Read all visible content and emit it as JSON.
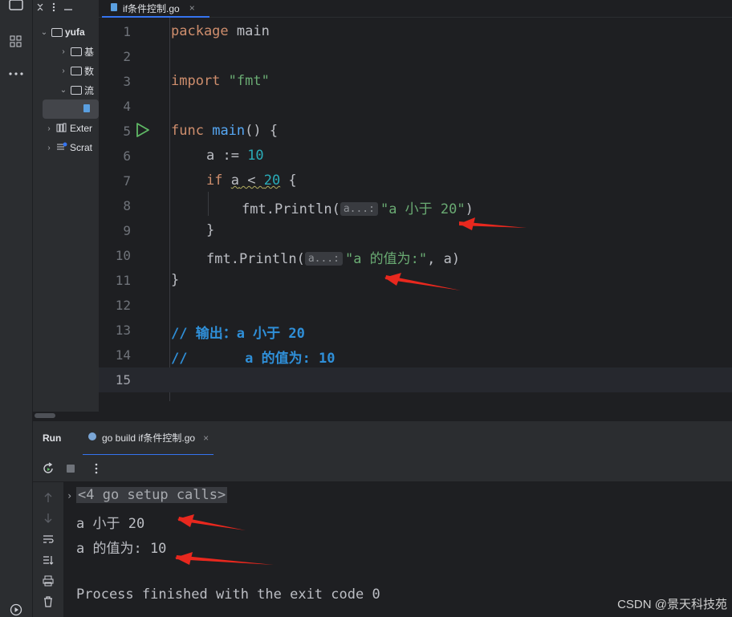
{
  "editor_tab": {
    "filename": "if条件控制.go",
    "close": "×"
  },
  "project": {
    "root": "yufa",
    "items": [
      "基",
      "数",
      "流",
      "Exter",
      "Scrat"
    ]
  },
  "code_lines": [
    {
      "n": "1"
    },
    {
      "n": "2"
    },
    {
      "n": "3"
    },
    {
      "n": "4"
    },
    {
      "n": "5"
    },
    {
      "n": "6"
    },
    {
      "n": "7"
    },
    {
      "n": "8"
    },
    {
      "n": "9"
    },
    {
      "n": "10"
    },
    {
      "n": "11"
    },
    {
      "n": "12"
    },
    {
      "n": "13"
    },
    {
      "n": "14"
    },
    {
      "n": "15"
    }
  ],
  "code": {
    "l1_kw": "package",
    "l1_rest": " main",
    "l3_kw": "import",
    "l3_str": "\"fmt\"",
    "l5_kw": "func",
    "l5_fn": "main",
    "l5_rest": "() {",
    "l6_a": "a := ",
    "l6_num": "10",
    "l7_kw": "if",
    "l7_a": "a",
    "l7_op": " < ",
    "l7_num": "20",
    "l7_rest": " {",
    "l8_call": "fmt.Println(",
    "l8_hint": "a...:",
    "l8_str": "\"a 小于 20\"",
    "l8_end": ")",
    "l9": "}",
    "l10_call": "fmt.Println(",
    "l10_hint": "a...:",
    "l10_str": "\"a 的值为:\"",
    "l10_end": ", a)",
    "l11": "}",
    "l13": "// 输出：a 小于 20",
    "l14": "//       a 的值为: 10"
  },
  "run_panel": {
    "title": "Run",
    "tab_label": "go build if条件控制.go",
    "tab_close": "×",
    "output": {
      "folded": "<4 go setup calls>",
      "line1": "a 小于 20",
      "line2": "a 的值为: 10",
      "line3": "Process finished with the exit code 0"
    }
  },
  "watermark": "CSDN @景天科技苑",
  "colors": {
    "accent": "#3574f0",
    "annotation_arrow": "#e8281e"
  }
}
